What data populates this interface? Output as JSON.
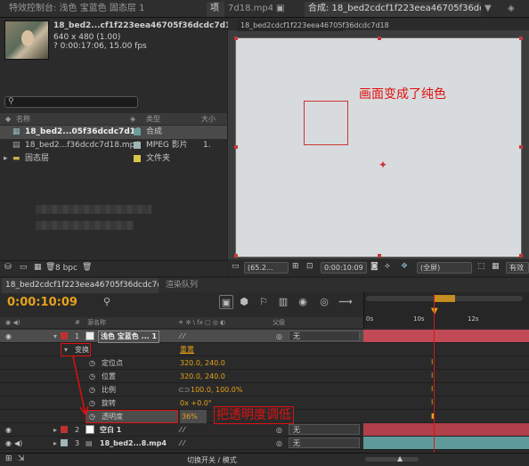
{
  "tabs": {
    "effects": "特效控制台: 浅色 宝蓝色 固态层 1",
    "project": "项",
    "footage": "7d18.mp4",
    "comp_panel": "18_bed2cdcf1f223eea46705f36dcdc7d18",
    "comp_panel_prefix": "合成: 18_bed2cdcf1f223eea46705f36dcdc7d18"
  },
  "project": {
    "selected_name": "18_bed2...cf1f223eea46705f36dcdc7d18▾",
    "info1": "640 x 480 (1.00)",
    "info2": "? 0:00:17:06, 15.00 fps",
    "search_icon": "magnifier-icon",
    "columns": {
      "name": "名称",
      "type": "类型",
      "size": "大小"
    },
    "items": [
      {
        "name": "18_bed2...05f36dcdc7d18",
        "type": "合成",
        "size": "",
        "color": "#6c9c9c"
      },
      {
        "name": "18_bed2...f36dcdc7d18.mp4",
        "type": "MPEG 影片",
        "size": "1.",
        "color": "#9fb6b6"
      },
      {
        "name": "固态层",
        "type": "文件夹",
        "size": "",
        "color": "#d8c44a"
      }
    ],
    "bpc": "8 bpc"
  },
  "comp": {
    "annotation": "画面变成了纯色",
    "zoom": "(65.2...",
    "time": "0:00:10:09",
    "quality": "(全屏)",
    "extra": "有效"
  },
  "timeline": {
    "tab_comp": "18_bed2cdcf1f223eea46705f36dcdc7d18",
    "tab_render": "渲染队列",
    "timecode": "0:00:10:09",
    "header": {
      "num": "#",
      "src": "源名称",
      "mode": "父级",
      "switches": "☀ ✲ \\ fx ▢ ◎ ◐"
    },
    "ruler": [
      "0s",
      "10s",
      "12s"
    ],
    "rows": [
      {
        "num": "1",
        "name": "浅色 宝蓝色 ... 1",
        "parent": "无",
        "color": "#c03030",
        "kind": "layer"
      },
      {
        "name": "变换",
        "reset": "重置",
        "kind": "group"
      },
      {
        "name": "定位点",
        "value": "320.0, 240.0",
        "kind": "prop"
      },
      {
        "name": "位置",
        "value": "320.0, 240.0",
        "kind": "prop"
      },
      {
        "name": "比例",
        "value": "100.0, 100.0%",
        "kind": "prop"
      },
      {
        "name": "旋转",
        "value": "0x +0.0°",
        "kind": "prop"
      },
      {
        "name": "透明度",
        "value": "36%",
        "kind": "prop"
      },
      {
        "num": "2",
        "name": "空白 1",
        "parent": "无",
        "color": "#c03030",
        "kind": "layer"
      },
      {
        "num": "3",
        "name": "18_bed2...8.mp4",
        "parent": "无",
        "color": "#9fb6b6",
        "kind": "layer"
      }
    ],
    "annotation": "把透明度调低",
    "status": "切换开关 / 模式"
  }
}
